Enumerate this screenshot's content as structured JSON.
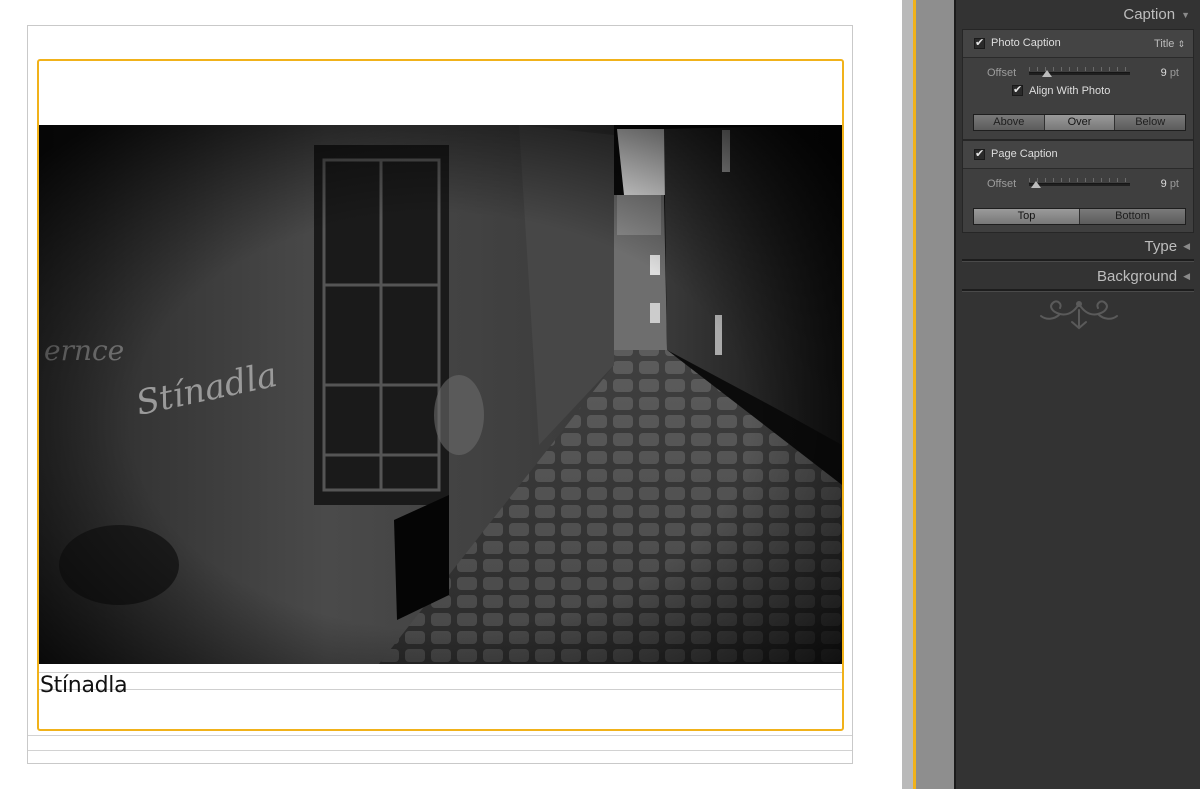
{
  "canvas": {
    "photo_caption": "Stínadla",
    "accent_color": "#f1b21a"
  },
  "panel": {
    "caption_section": {
      "title": "Caption",
      "collapse_icon": "triangle-down-icon",
      "photo_caption": {
        "label": "Photo Caption",
        "checked": true,
        "source_value": "Title",
        "offset_label": "Offset",
        "offset_value": "9",
        "offset_unit": "pt",
        "align_with_photo_label": "Align With Photo",
        "align_checked": true,
        "positions": [
          "Above",
          "Over",
          "Below"
        ],
        "selected_position": "Over"
      },
      "page_caption": {
        "label": "Page Caption",
        "checked": true,
        "offset_label": "Offset",
        "offset_value": "9",
        "offset_unit": "pt",
        "positions": [
          "Top",
          "Bottom"
        ],
        "selected_position": "Top"
      }
    },
    "type_section": {
      "title": "Type",
      "expand_icon": "triangle-left-icon"
    },
    "background_section": {
      "title": "Background",
      "expand_icon": "triangle-left-icon"
    },
    "end_ornament_icon": "flourish-ornament-icon"
  }
}
